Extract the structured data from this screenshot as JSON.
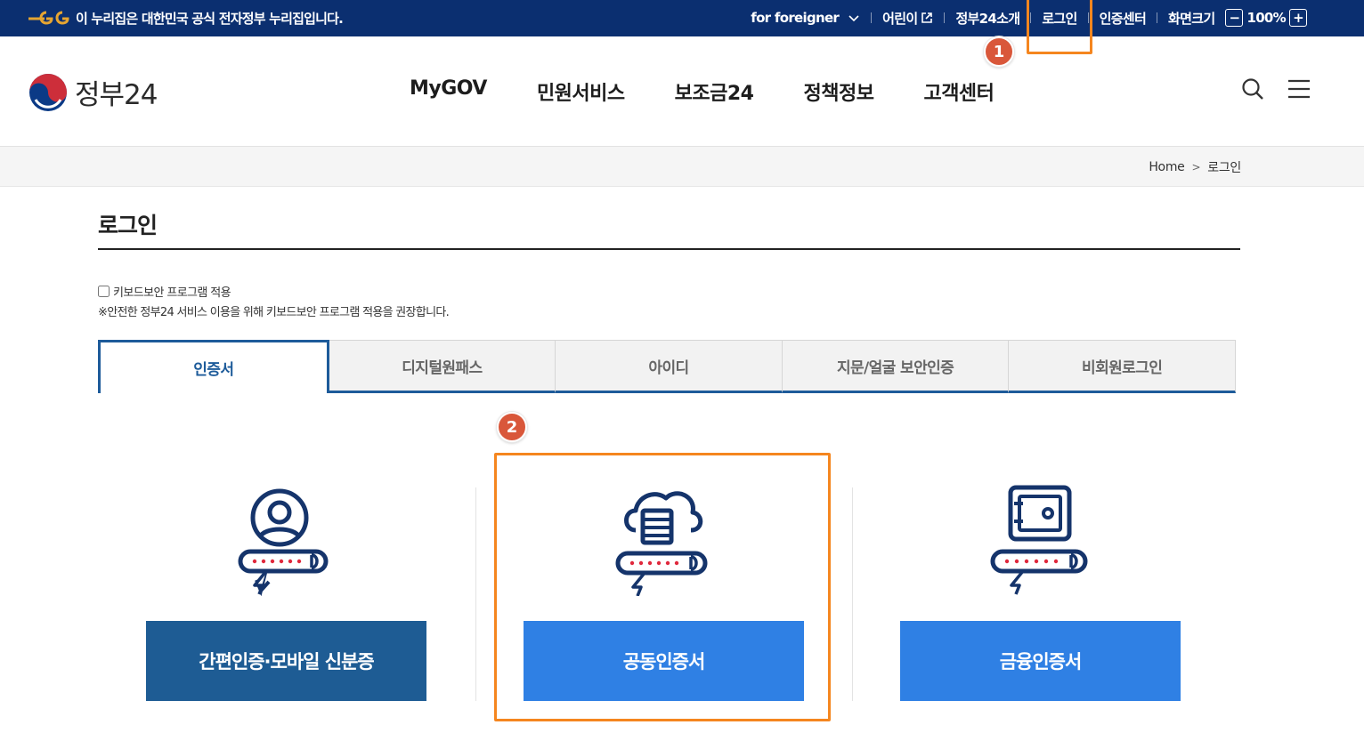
{
  "topbar": {
    "gov_text": "이 누리집은 대한민국 공식 전자정부 누리집입니다.",
    "for_foreigner": "for foreigner",
    "kids": "어린이",
    "about": "정부24소개",
    "login": "로그인",
    "cert_center": "인증센터",
    "screen_size": "화면크기",
    "zoom_minus": "−",
    "zoom_level": "100%",
    "zoom_plus": "+"
  },
  "header": {
    "logo_text": "정부24",
    "nav": [
      "MyGOV",
      "민원서비스",
      "보조금24",
      "정책정보",
      "고객센터"
    ]
  },
  "breadcrumb": {
    "home": "Home",
    "chevron": ">",
    "current": "로그인"
  },
  "page": {
    "title": "로그인",
    "keyboard_security_label": "키보드보안 프로그램 적용",
    "keyboard_security_note": "※안전한 정부24 서비스 이용을 위해 키보드보안 프로그램 적용을 권장합니다."
  },
  "tabs": [
    "인증서",
    "디지털원패스",
    "아이디",
    "지문/얼굴 보안인증",
    "비회원로그인"
  ],
  "cards": {
    "simple_auth": "간편인증·모바일 신분증",
    "joint_cert": "공동인증서",
    "financial_cert": "금융인증서"
  },
  "markers": {
    "one": "1",
    "two": "2"
  },
  "colors": {
    "topbar_bg": "#0b2f70",
    "primary_dark": "#1e5c94",
    "primary_blue": "#2f80e4",
    "highlight": "#f5861f",
    "marker": "#d9573a"
  }
}
